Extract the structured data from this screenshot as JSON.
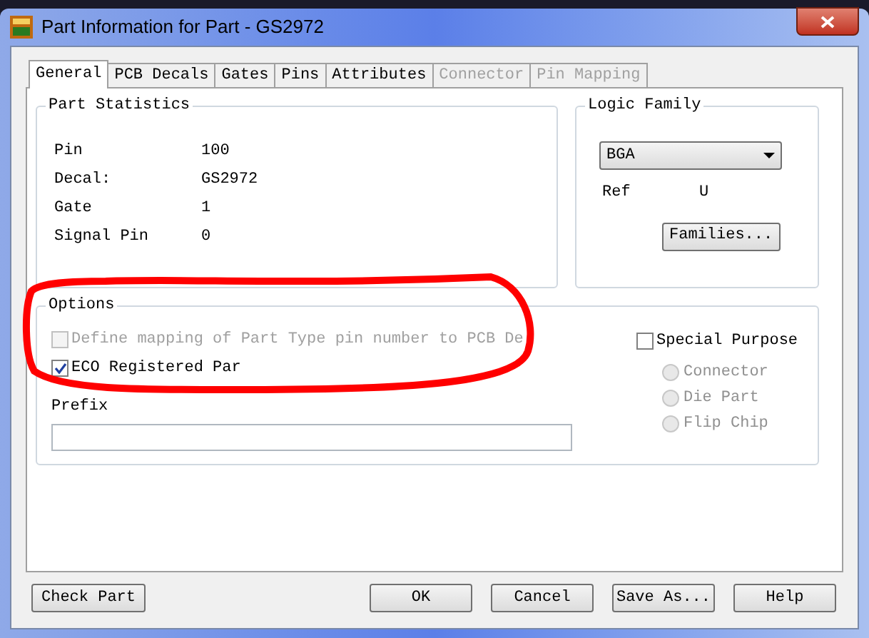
{
  "window": {
    "title": "Part Information for Part - GS2972"
  },
  "tabs": [
    {
      "label": "General",
      "selected": true,
      "disabled": false
    },
    {
      "label": "PCB Decals",
      "selected": false,
      "disabled": false
    },
    {
      "label": "Gates",
      "selected": false,
      "disabled": false
    },
    {
      "label": "Pins",
      "selected": false,
      "disabled": false
    },
    {
      "label": "Attributes",
      "selected": false,
      "disabled": false
    },
    {
      "label": "Connector",
      "selected": false,
      "disabled": true
    },
    {
      "label": "Pin Mapping",
      "selected": false,
      "disabled": true
    }
  ],
  "part_statistics": {
    "title": "Part Statistics",
    "rows": [
      {
        "label": "Pin",
        "value": "100"
      },
      {
        "label": "Decal:",
        "value": "GS2972"
      },
      {
        "label": "Gate",
        "value": "1"
      },
      {
        "label": "Signal Pin",
        "value": "0"
      }
    ]
  },
  "logic_family": {
    "title": "Logic Family",
    "dropdown": {
      "value": "BGA"
    },
    "ref_label": "Ref",
    "ref_value": "U",
    "families_button": "Families..."
  },
  "options": {
    "title": "Options",
    "checkboxes": [
      {
        "label": "Define mapping of Part Type pin number to PCB De",
        "checked": false,
        "disabled": true
      },
      {
        "label": "ECO Registered Par",
        "checked": true,
        "disabled": false
      }
    ],
    "prefix": {
      "label": "Prefix"
    },
    "special_purpose": {
      "label": "Special Purpose",
      "checked": false,
      "radios": [
        {
          "label": "Connector",
          "selected": false,
          "disabled": true
        },
        {
          "label": "Die Part",
          "selected": false,
          "disabled": true
        },
        {
          "label": "Flip Chip",
          "selected": false,
          "disabled": true
        }
      ]
    }
  },
  "buttons": {
    "check_part": "Check Part",
    "actions": [
      "OK",
      "Cancel",
      "Save As...",
      "Help"
    ]
  }
}
